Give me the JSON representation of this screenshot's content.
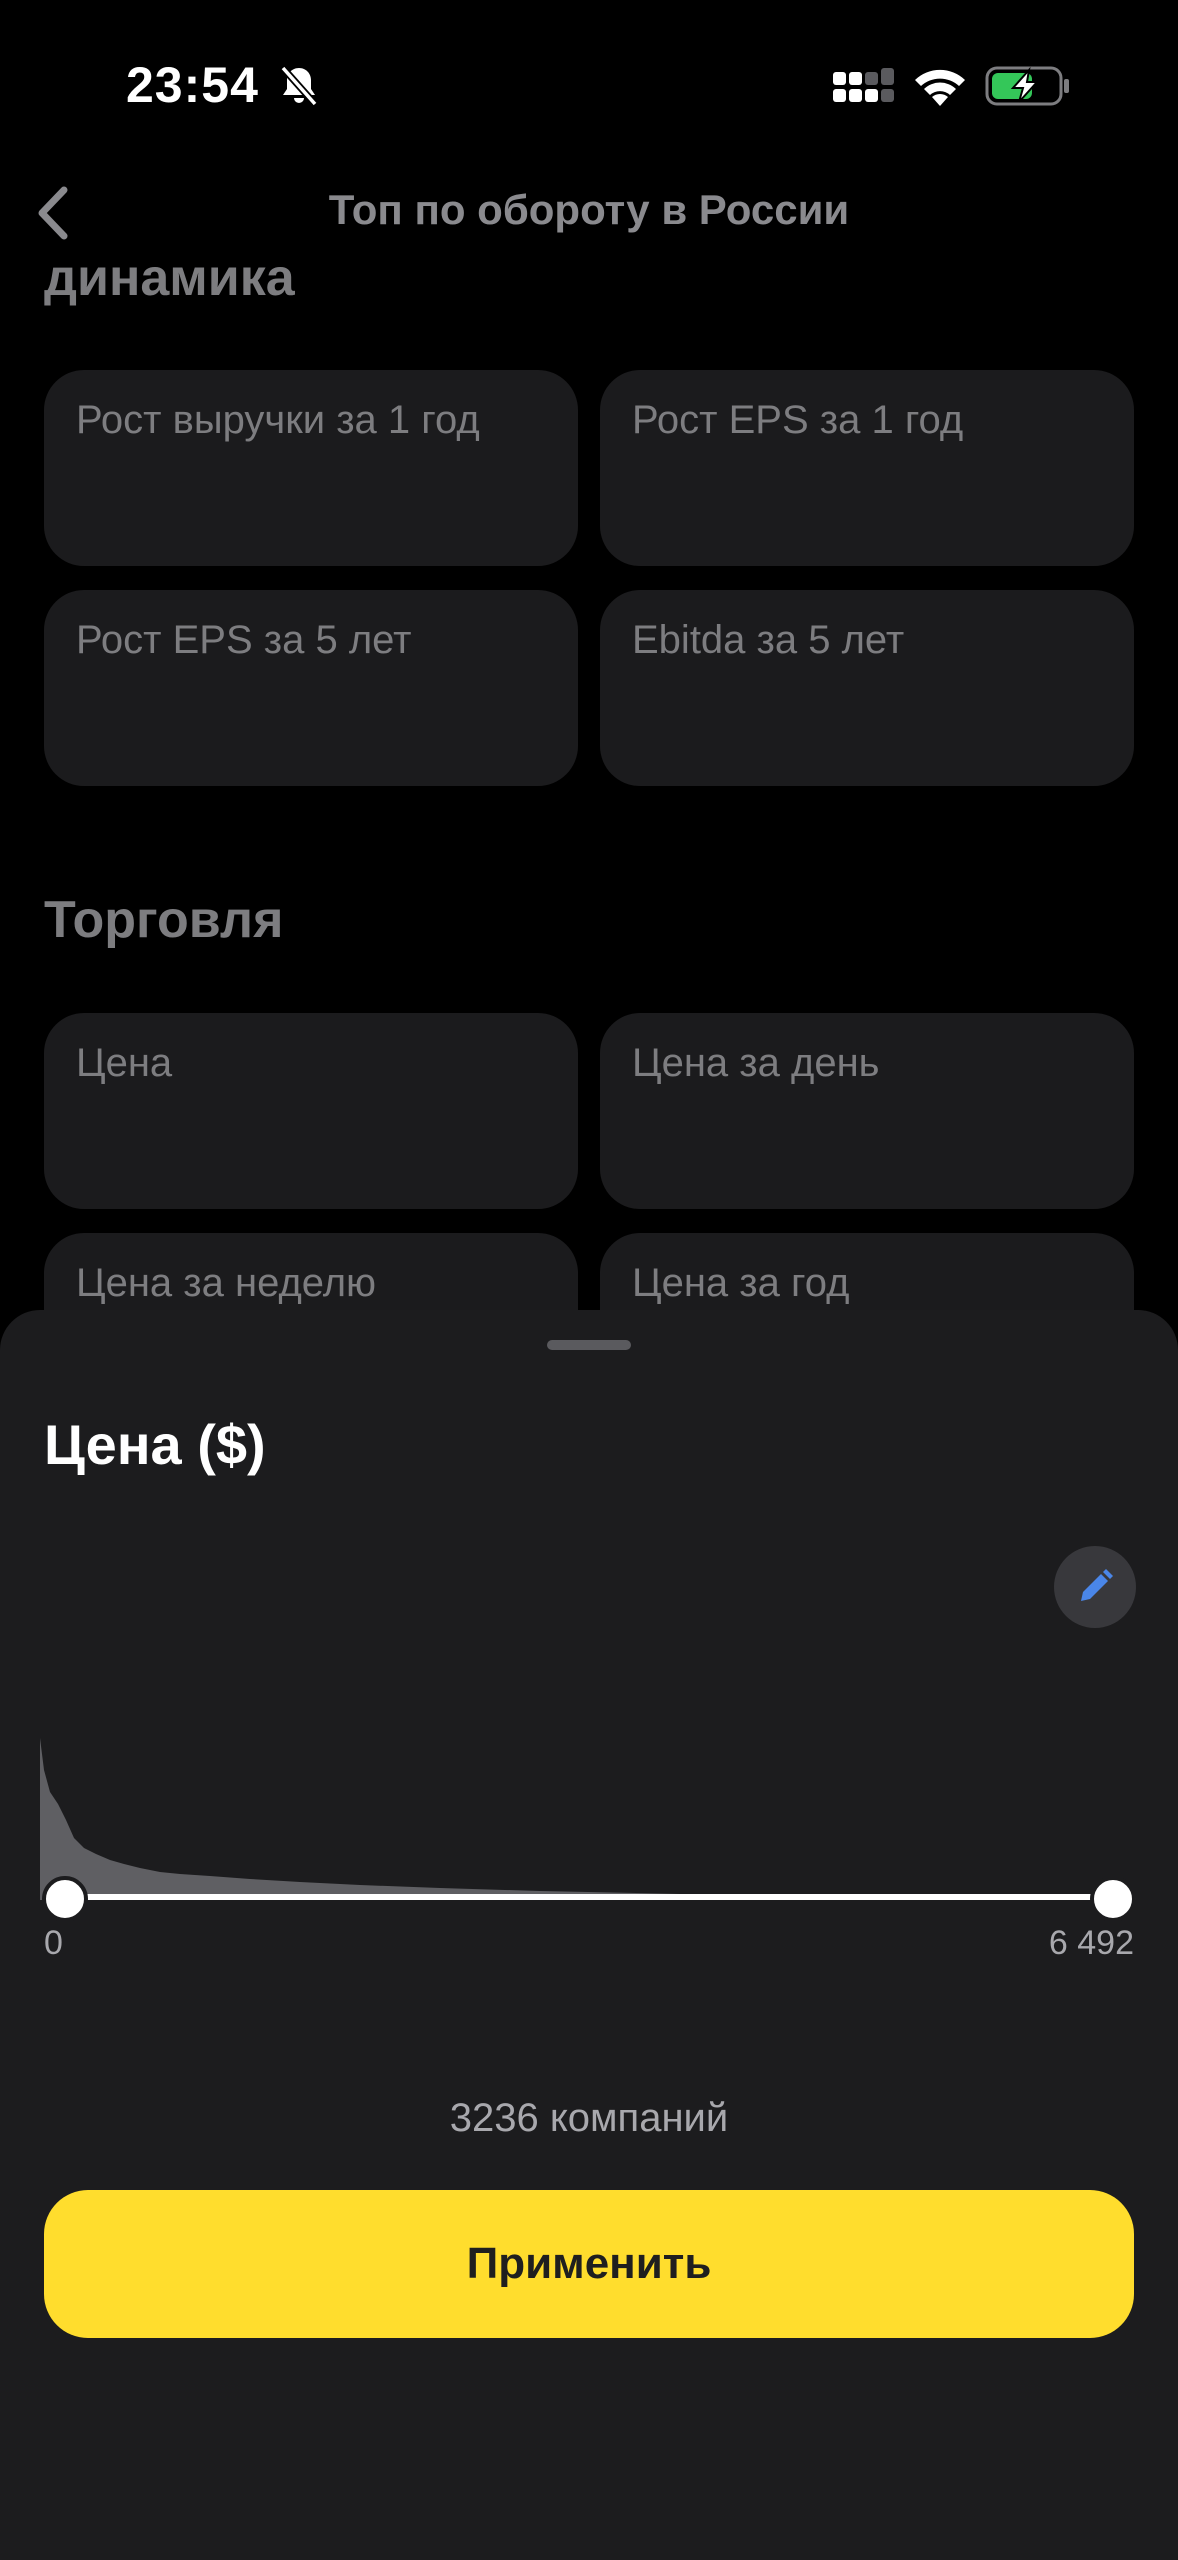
{
  "status_bar": {
    "time": "23:54"
  },
  "nav": {
    "title": "Топ по обороту в России"
  },
  "sections": [
    {
      "heading": "динамика",
      "cards": [
        "Рост выручки за 1 год",
        "Рост EPS за 1 год",
        "Рост EPS за 5 лет",
        "Ebitda за 5 лет"
      ]
    },
    {
      "heading": "Торговля",
      "cards": [
        "Цена",
        "Цена за день",
        "Цена за неделю",
        "Цена за год"
      ]
    }
  ],
  "sheet": {
    "title": "Цена ($)",
    "range_min": "0",
    "range_max": "6 492",
    "company_count": "3236 компаний",
    "apply_label": "Применить"
  },
  "colors": {
    "accent": "#ffdd2d",
    "edit_icon": "#4a86e8",
    "sheet_bg": "#1c1c1e",
    "card_bg": "#1b1b1d"
  },
  "icons": {
    "back": "chevron-left-icon",
    "silent": "bell-slash-icon",
    "signal": "signal-icon",
    "wifi": "wifi-icon",
    "battery": "battery-charging-icon",
    "edit": "pencil-icon"
  }
}
